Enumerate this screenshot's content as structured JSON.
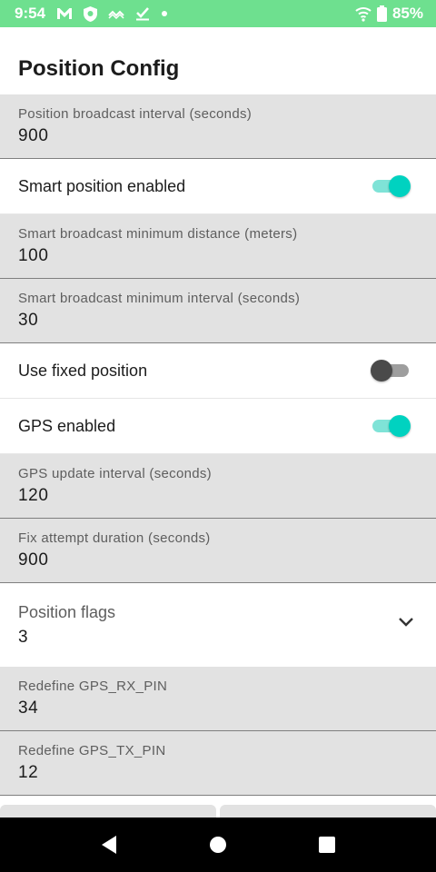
{
  "status_bar": {
    "time": "9:54",
    "battery": "85%",
    "icons": [
      "gmail-icon",
      "shield-icon",
      "signal-waves-icon",
      "download-check-icon",
      "dot-icon",
      "wifi-icon",
      "battery-icon"
    ]
  },
  "page": {
    "title": "Position Config"
  },
  "fields": [
    {
      "label": "Position broadcast interval (seconds)",
      "value": "900"
    },
    {
      "label": "Smart broadcast minimum distance (meters)",
      "value": "100"
    },
    {
      "label": "Smart broadcast minimum interval (seconds)",
      "value": "30"
    },
    {
      "label": "GPS update interval (seconds)",
      "value": "120"
    },
    {
      "label": "Fix attempt duration (seconds)",
      "value": "900"
    },
    {
      "label": "Redefine GPS_RX_PIN",
      "value": "34"
    },
    {
      "label": "Redefine GPS_TX_PIN",
      "value": "12"
    }
  ],
  "toggles": [
    {
      "label": "Smart position enabled",
      "on": true
    },
    {
      "label": "Use fixed position",
      "on": false
    },
    {
      "label": "GPS enabled",
      "on": true
    }
  ],
  "dropdown": {
    "label": "Position flags",
    "value": "3"
  },
  "colors": {
    "status_bar": "#6ee08f",
    "accent": "#00d2c0",
    "field_background": "#e2e2e2",
    "nav_bar": "#000000"
  }
}
